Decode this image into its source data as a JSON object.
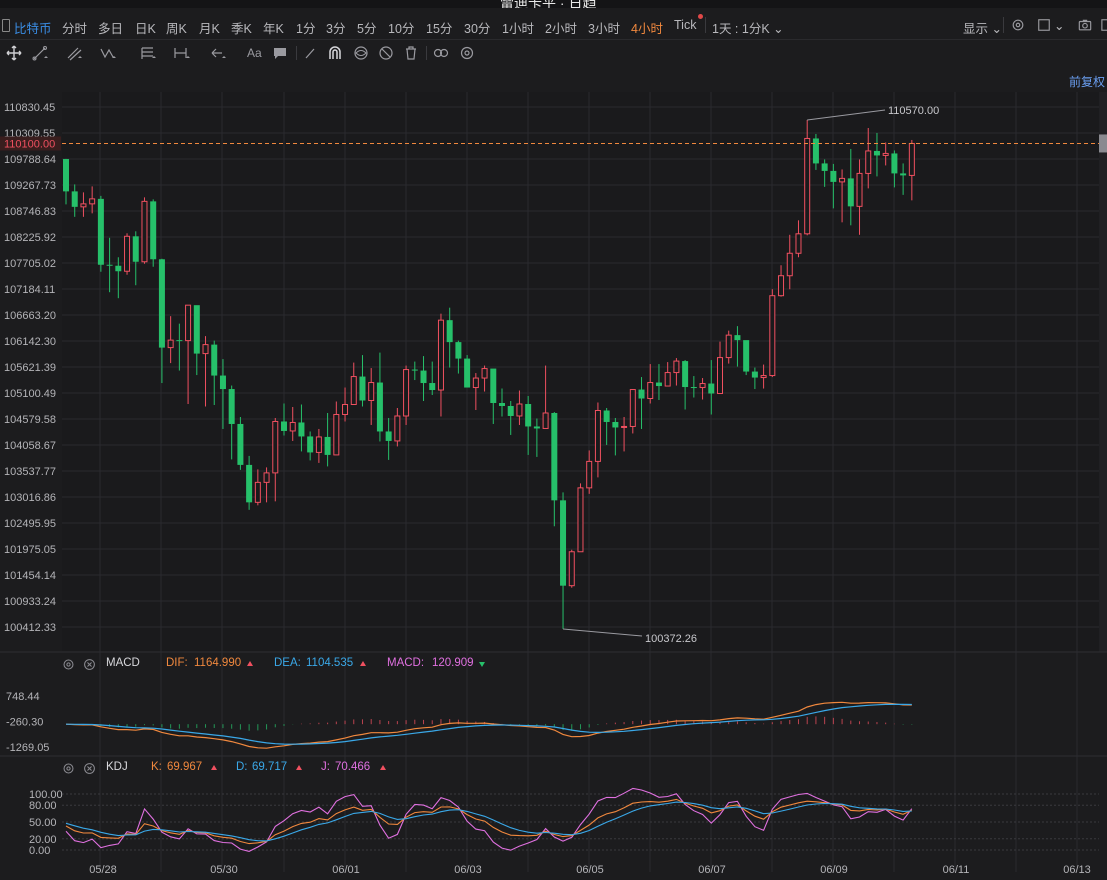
{
  "window": {
    "title": "雷迪卡平 · 日趋"
  },
  "period_bar": {
    "symbol": "比特币",
    "periods": [
      "分时",
      "多日",
      "日K",
      "周K",
      "月K",
      "季K",
      "年K",
      "1分",
      "3分",
      "5分",
      "10分",
      "15分",
      "30分",
      "1小时",
      "2小时",
      "3小时",
      "4小时",
      "Tick"
    ],
    "active_period": "4小时",
    "multi_view": "1天 : 1分K",
    "display": "显示"
  },
  "draw_toolbar": {
    "font_label": "Aa"
  },
  "restoration": "前复权",
  "price_axis": {
    "labels": [
      "110830.45",
      "110309.55",
      "109788.64",
      "109267.73",
      "108746.83",
      "108225.92",
      "107705.02",
      "107184.11",
      "106663.20",
      "106142.30",
      "105621.39",
      "105100.49",
      "104579.58",
      "104058.67",
      "103537.77",
      "103016.86",
      "102495.95",
      "101975.05",
      "101454.14",
      "100933.24",
      "100412.33"
    ],
    "current_price": "110100.00"
  },
  "annotations": {
    "high": "110570.00",
    "low": "100372.26"
  },
  "date_axis": [
    "05/28",
    "05/30",
    "06/01",
    "06/03",
    "06/05",
    "06/07",
    "06/09",
    "06/11",
    "06/13"
  ],
  "macd": {
    "name": "MACD",
    "dif_label": "DIF:",
    "dif": "1164.990",
    "dea_label": "DEA:",
    "dea": "1104.535",
    "macd_label": "MACD:",
    "macd": "120.909",
    "axis": [
      "748.44",
      "-260.30",
      "-1269.05"
    ]
  },
  "kdj": {
    "name": "KDJ",
    "k_label": "K:",
    "k": "69.967",
    "d_label": "D:",
    "d": "69.717",
    "j_label": "J:",
    "j": "70.466",
    "axis": [
      "100.00",
      "80.00",
      "50.00",
      "20.00",
      "0.00"
    ]
  },
  "colors": {
    "up": "#f05060",
    "down": "#26c06a",
    "accent": "#f0883e",
    "link": "#3a8ee6",
    "dea": "#3aa8e8",
    "j": "#e070e0"
  },
  "chart_data": {
    "type": "candlestick",
    "interval": "4小时",
    "y_axis": {
      "min": 100412.33,
      "max": 110830.45
    },
    "current_price": 110100.0,
    "high": 110570.0,
    "low": 100372.26,
    "candles": [
      [
        109788,
        109140,
        109790,
        108880
      ],
      [
        109140,
        108830,
        109280,
        108630
      ],
      [
        108830,
        108890,
        109120,
        108630
      ],
      [
        108890,
        108990,
        109240,
        108700
      ],
      [
        108990,
        107670,
        109050,
        107530
      ],
      [
        107670,
        107650,
        108210,
        107120
      ],
      [
        107650,
        107540,
        107820,
        107000
      ],
      [
        107540,
        108240,
        108300,
        107470
      ],
      [
        108240,
        107730,
        108340,
        107260
      ],
      [
        107730,
        108940,
        109020,
        107690
      ],
      [
        108940,
        107780,
        108980,
        107630
      ],
      [
        107780,
        106010,
        107790,
        105300
      ],
      [
        106010,
        106160,
        106640,
        105700
      ],
      [
        106160,
        106150,
        106490,
        105550
      ],
      [
        106150,
        106860,
        106290,
        104880
      ],
      [
        106860,
        105890,
        106210,
        105460
      ],
      [
        105890,
        106070,
        106240,
        104830
      ],
      [
        106070,
        105450,
        106150,
        104860
      ],
      [
        105450,
        105180,
        105780,
        104380
      ],
      [
        105180,
        104480,
        105250,
        103770
      ],
      [
        104480,
        103660,
        104620,
        103560
      ],
      [
        103660,
        102910,
        103840,
        102760
      ],
      [
        102910,
        103310,
        103570,
        102850
      ],
      [
        103310,
        103500,
        103610,
        102910
      ],
      [
        103500,
        104530,
        104600,
        102930
      ],
      [
        104530,
        104340,
        104890,
        104250
      ],
      [
        104340,
        104510,
        104820,
        104140
      ],
      [
        104510,
        104230,
        104870,
        103930
      ],
      [
        104230,
        103910,
        104330,
        103750
      ],
      [
        103910,
        104220,
        104380,
        103700
      ],
      [
        104220,
        103860,
        104700,
        103630
      ],
      [
        103860,
        104670,
        104930,
        103980
      ],
      [
        104670,
        104870,
        105210,
        104530
      ],
      [
        104870,
        105430,
        105710,
        104860
      ],
      [
        105430,
        104950,
        105860,
        104830
      ],
      [
        104950,
        105310,
        105600,
        104460
      ],
      [
        105310,
        104330,
        105910,
        104130
      ],
      [
        104330,
        104140,
        104600,
        103760
      ],
      [
        104140,
        104640,
        104800,
        104030
      ],
      [
        104640,
        105570,
        105650,
        104460
      ],
      [
        105570,
        105550,
        105730,
        105360
      ],
      [
        105550,
        105300,
        105840,
        104940
      ],
      [
        105300,
        105160,
        105730,
        105060
      ],
      [
        105160,
        106560,
        106690,
        104630
      ],
      [
        106560,
        106120,
        106810,
        105610
      ],
      [
        106120,
        105790,
        106150,
        105490
      ],
      [
        105790,
        105210,
        105860,
        105220
      ],
      [
        105210,
        105400,
        105500,
        104760
      ],
      [
        105400,
        105590,
        105650,
        105130
      ],
      [
        105590,
        104900,
        105560,
        104480
      ],
      [
        104900,
        104840,
        105190,
        104630
      ],
      [
        104840,
        104640,
        104940,
        104260
      ],
      [
        104640,
        104880,
        105150,
        104460
      ],
      [
        104880,
        104430,
        105040,
        103860
      ],
      [
        104430,
        104390,
        104590,
        103820
      ],
      [
        104390,
        104700,
        105650,
        104460
      ],
      [
        104700,
        102950,
        104720,
        102430
      ],
      [
        102950,
        101240,
        103110,
        100372
      ],
      [
        101240,
        101920,
        101960,
        101200
      ],
      [
        101920,
        103200,
        103290,
        102600
      ],
      [
        103200,
        103730,
        103950,
        103080
      ],
      [
        103730,
        104750,
        104910,
        103410
      ],
      [
        104750,
        104520,
        104800,
        104060
      ],
      [
        104520,
        104410,
        104600,
        103850
      ],
      [
        104410,
        104430,
        104620,
        103930
      ],
      [
        104430,
        105170,
        105180,
        104290
      ],
      [
        105170,
        104990,
        105420,
        104380
      ],
      [
        104990,
        105310,
        105680,
        104890
      ],
      [
        105310,
        105240,
        105680,
        104960
      ],
      [
        105240,
        105510,
        105720,
        105260
      ],
      [
        105510,
        105740,
        105800,
        105250
      ],
      [
        105740,
        105220,
        105760,
        104770
      ],
      [
        105220,
        105210,
        105440,
        105010
      ],
      [
        105210,
        105290,
        105400,
        104970
      ],
      [
        105290,
        105090,
        105760,
        104670
      ],
      [
        105090,
        105810,
        106130,
        105680
      ],
      [
        105810,
        106260,
        106350,
        105690
      ],
      [
        106260,
        106160,
        106440,
        105630
      ],
      [
        106160,
        105530,
        106150,
        105460
      ],
      [
        105530,
        105410,
        105610,
        105180
      ],
      [
        105410,
        105450,
        105670,
        105190
      ],
      [
        105450,
        107050,
        107180,
        105420
      ],
      [
        107050,
        107450,
        107660,
        107030
      ],
      [
        107450,
        107900,
        108270,
        107180
      ],
      [
        107900,
        108290,
        108560,
        107820
      ],
      [
        108290,
        110200,
        110570,
        108260
      ],
      [
        110200,
        109700,
        110290,
        109570
      ],
      [
        109700,
        109550,
        109780,
        109230
      ],
      [
        109550,
        109330,
        109690,
        108800
      ],
      [
        109330,
        109400,
        109580,
        108520
      ],
      [
        109400,
        108840,
        109990,
        108460
      ],
      [
        108840,
        109500,
        109780,
        108270
      ],
      [
        109500,
        109950,
        110410,
        109200
      ],
      [
        109950,
        109860,
        110310,
        109440
      ],
      [
        109860,
        109900,
        110120,
        109660
      ],
      [
        109900,
        109500,
        109960,
        109220
      ],
      [
        109500,
        109460,
        109700,
        109070
      ],
      [
        109460,
        110100,
        110170,
        108960
      ]
    ]
  }
}
